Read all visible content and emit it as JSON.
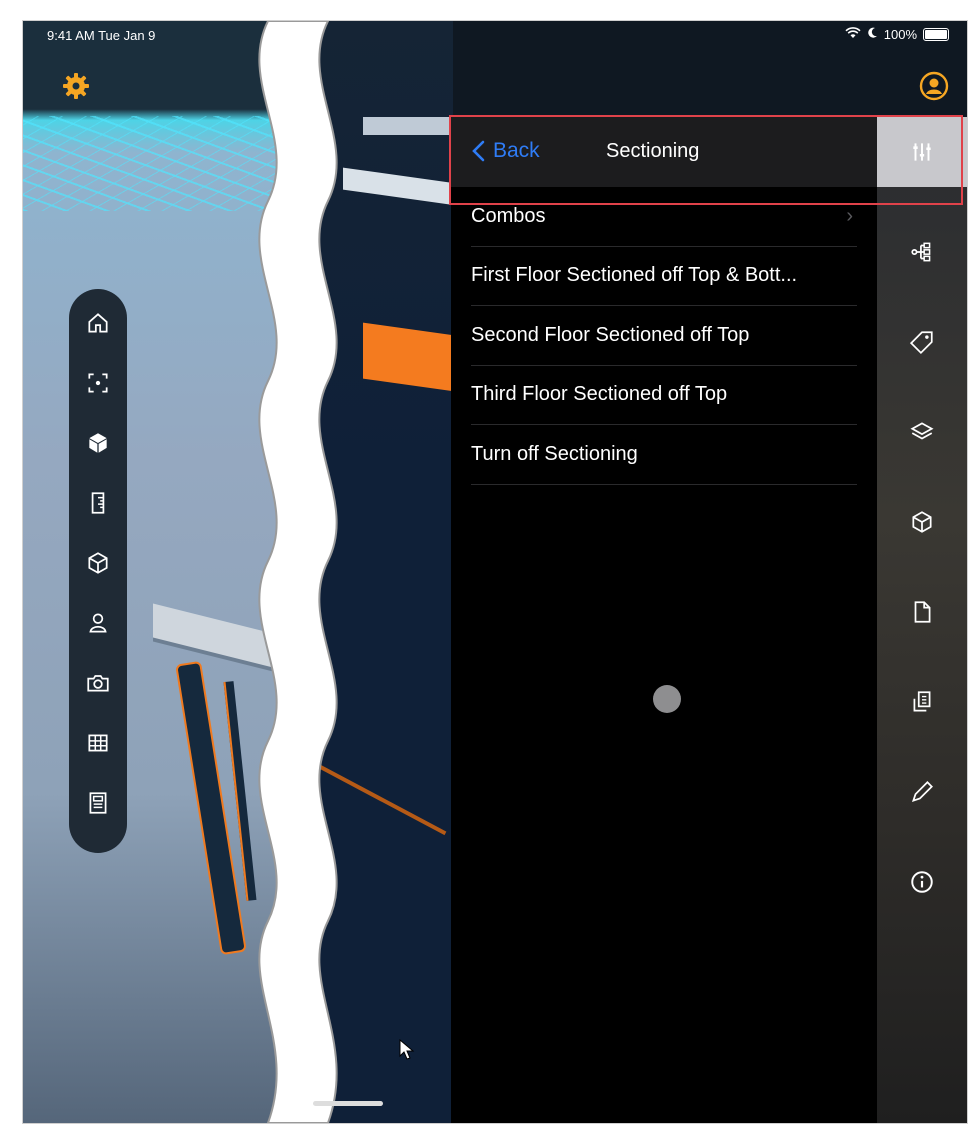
{
  "status_bar": {
    "time": "9:41 AM   Tue Jan 9",
    "battery": "100%"
  },
  "panel": {
    "back_label": "Back",
    "title": "Sectioning",
    "items": [
      {
        "label": "Combos",
        "has_chevron": true
      },
      {
        "label": "First Floor Sectioned off Top & Bott..."
      },
      {
        "label": "Second Floor Sectioned off Top"
      },
      {
        "label": "Third Floor Sectioned off Top"
      },
      {
        "label": "Turn off Sectioning"
      }
    ]
  },
  "left_toolbar": {
    "icons": [
      "home-icon",
      "focus-icon",
      "cube-filled-icon",
      "ruler-icon",
      "cube-outline-icon",
      "person-icon",
      "camera-icon",
      "grid-icon",
      "floorplan-icon"
    ]
  },
  "right_rail": {
    "icons": [
      "sliders-icon",
      "hierarchy-icon",
      "tag-icon",
      "layers-icon",
      "box-icon",
      "document-icon",
      "sheets-icon",
      "pen-icon",
      "info-icon"
    ],
    "active": "sliders-icon"
  },
  "colors": {
    "accent": "#2f7cf6",
    "gear": "#f5a623",
    "highlight": "#e0424a",
    "panel_bg": "#000000"
  }
}
